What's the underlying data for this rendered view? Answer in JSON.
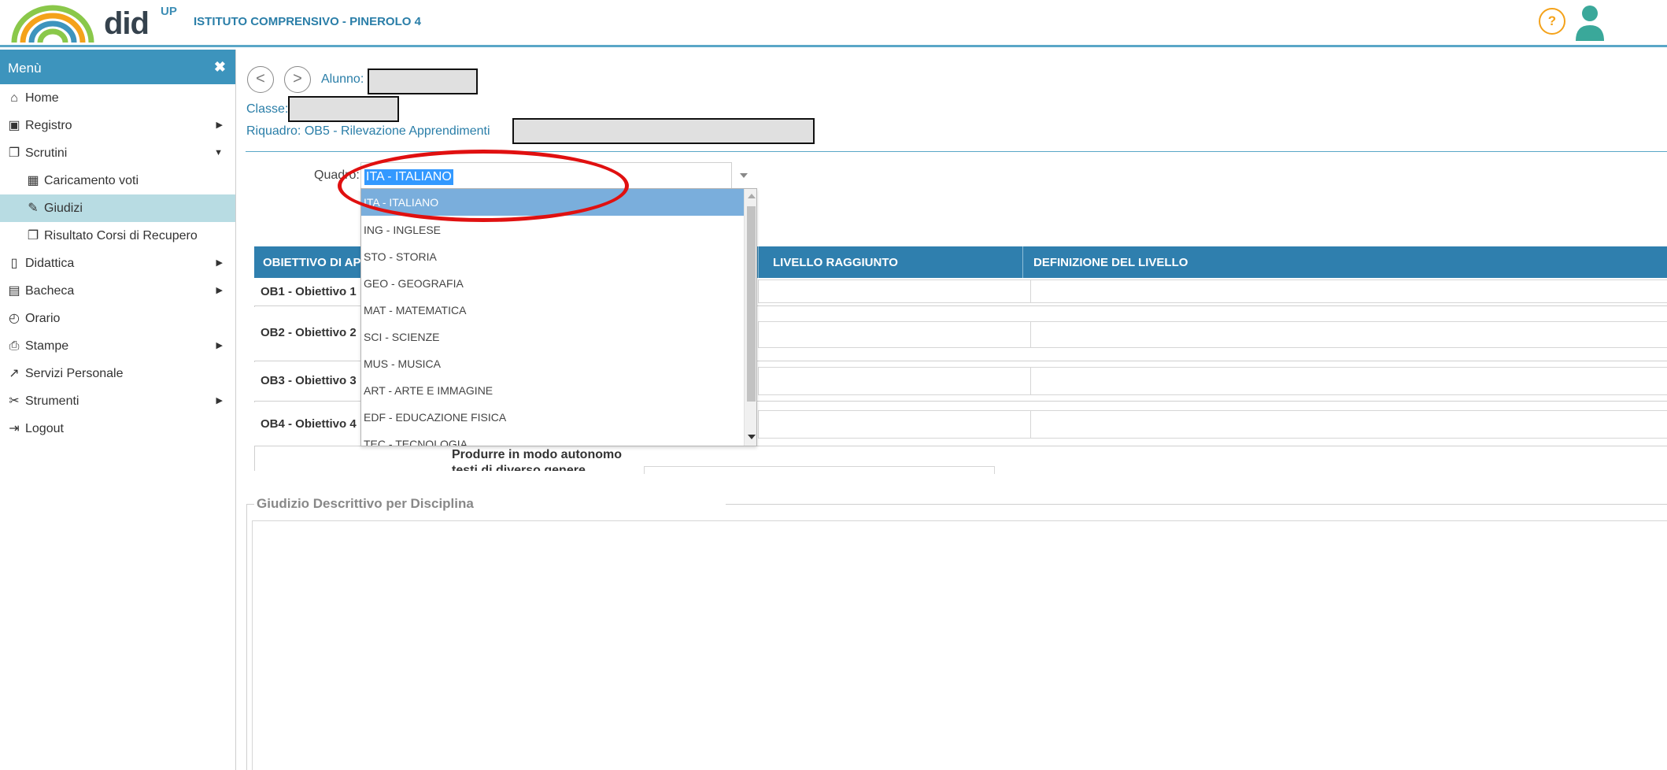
{
  "header": {
    "logo_main": "did",
    "logo_sup": "UP",
    "school": "ISTITUTO COMPRENSIVO - PINEROLO 4",
    "help_label": "?",
    "colors": {
      "accent": "#2a7ea8",
      "help": "#f4a21a"
    }
  },
  "sidebar": {
    "title": "Menù",
    "close": "✖",
    "items": [
      {
        "label": "Home",
        "icon": "home-icon",
        "glyph": "⌂"
      },
      {
        "label": "Registro",
        "icon": "calendar-check-icon",
        "glyph": "▣",
        "arrow": "▶"
      },
      {
        "label": "Scrutini",
        "icon": "document-icon",
        "glyph": "❐",
        "arrow": "▼"
      },
      {
        "label": "Caricamento voti",
        "icon": "grid-icon",
        "glyph": "▦"
      },
      {
        "label": "Giudizi",
        "icon": "edit-icon",
        "glyph": "✎"
      },
      {
        "label": "Risultato Corsi di Recupero",
        "icon": "document-icon",
        "glyph": "❐"
      },
      {
        "label": "Didattica",
        "icon": "book-icon",
        "glyph": "▯",
        "arrow": "▶"
      },
      {
        "label": "Bacheca",
        "icon": "board-icon",
        "glyph": "▤",
        "arrow": "▶"
      },
      {
        "label": "Orario",
        "icon": "clock-icon",
        "glyph": "◴"
      },
      {
        "label": "Stampe",
        "icon": "print-icon",
        "glyph": "⎙",
        "arrow": "▶"
      },
      {
        "label": "Servizi Personale",
        "icon": "share-icon",
        "glyph": "↗"
      },
      {
        "label": "Strumenti",
        "icon": "tools-icon",
        "glyph": "✂",
        "arrow": "▶"
      },
      {
        "label": "Logout",
        "icon": "logout-icon",
        "glyph": "⇥"
      }
    ]
  },
  "info": {
    "nav_back": "<",
    "nav_forward": ">",
    "alunno_label": "Alunno:",
    "classe_label": "Classe:",
    "riquadro_label": "Riquadro: OB5 - Rilevazione Apprendimenti"
  },
  "quadro": {
    "label": "Quadro:",
    "value": "ITA - ITALIANO",
    "options": [
      "ITA - ITALIANO",
      "ING - INGLESE",
      "STO - STORIA",
      "GEO - GEOGRAFIA",
      "MAT - MATEMATICA",
      "SCI - SCIENZE",
      "MUS - MUSICA",
      "ART - ARTE E IMMAGINE",
      "EDF - EDUCAZIONE FISICA",
      "TEC - TECNOLOGIA"
    ]
  },
  "table": {
    "headers": [
      "OBIETTIVO DI AP",
      "LIVELLO RAGGIUNTO",
      "DEFINIZIONE DEL LIVELLO"
    ],
    "rows": [
      {
        "label": "OB1 - Obiettivo 1"
      },
      {
        "label": "OB2 - Obiettivo 2"
      },
      {
        "label": "OB3 - Obiettivo 3"
      },
      {
        "label": "OB4 - Obiettivo 4"
      }
    ],
    "partial_line1": "Produrre in modo autonomo",
    "partial_line2": "testi di diverso genere"
  },
  "giudizio": {
    "legend": "Giudizio Descrittivo per Disciplina"
  }
}
